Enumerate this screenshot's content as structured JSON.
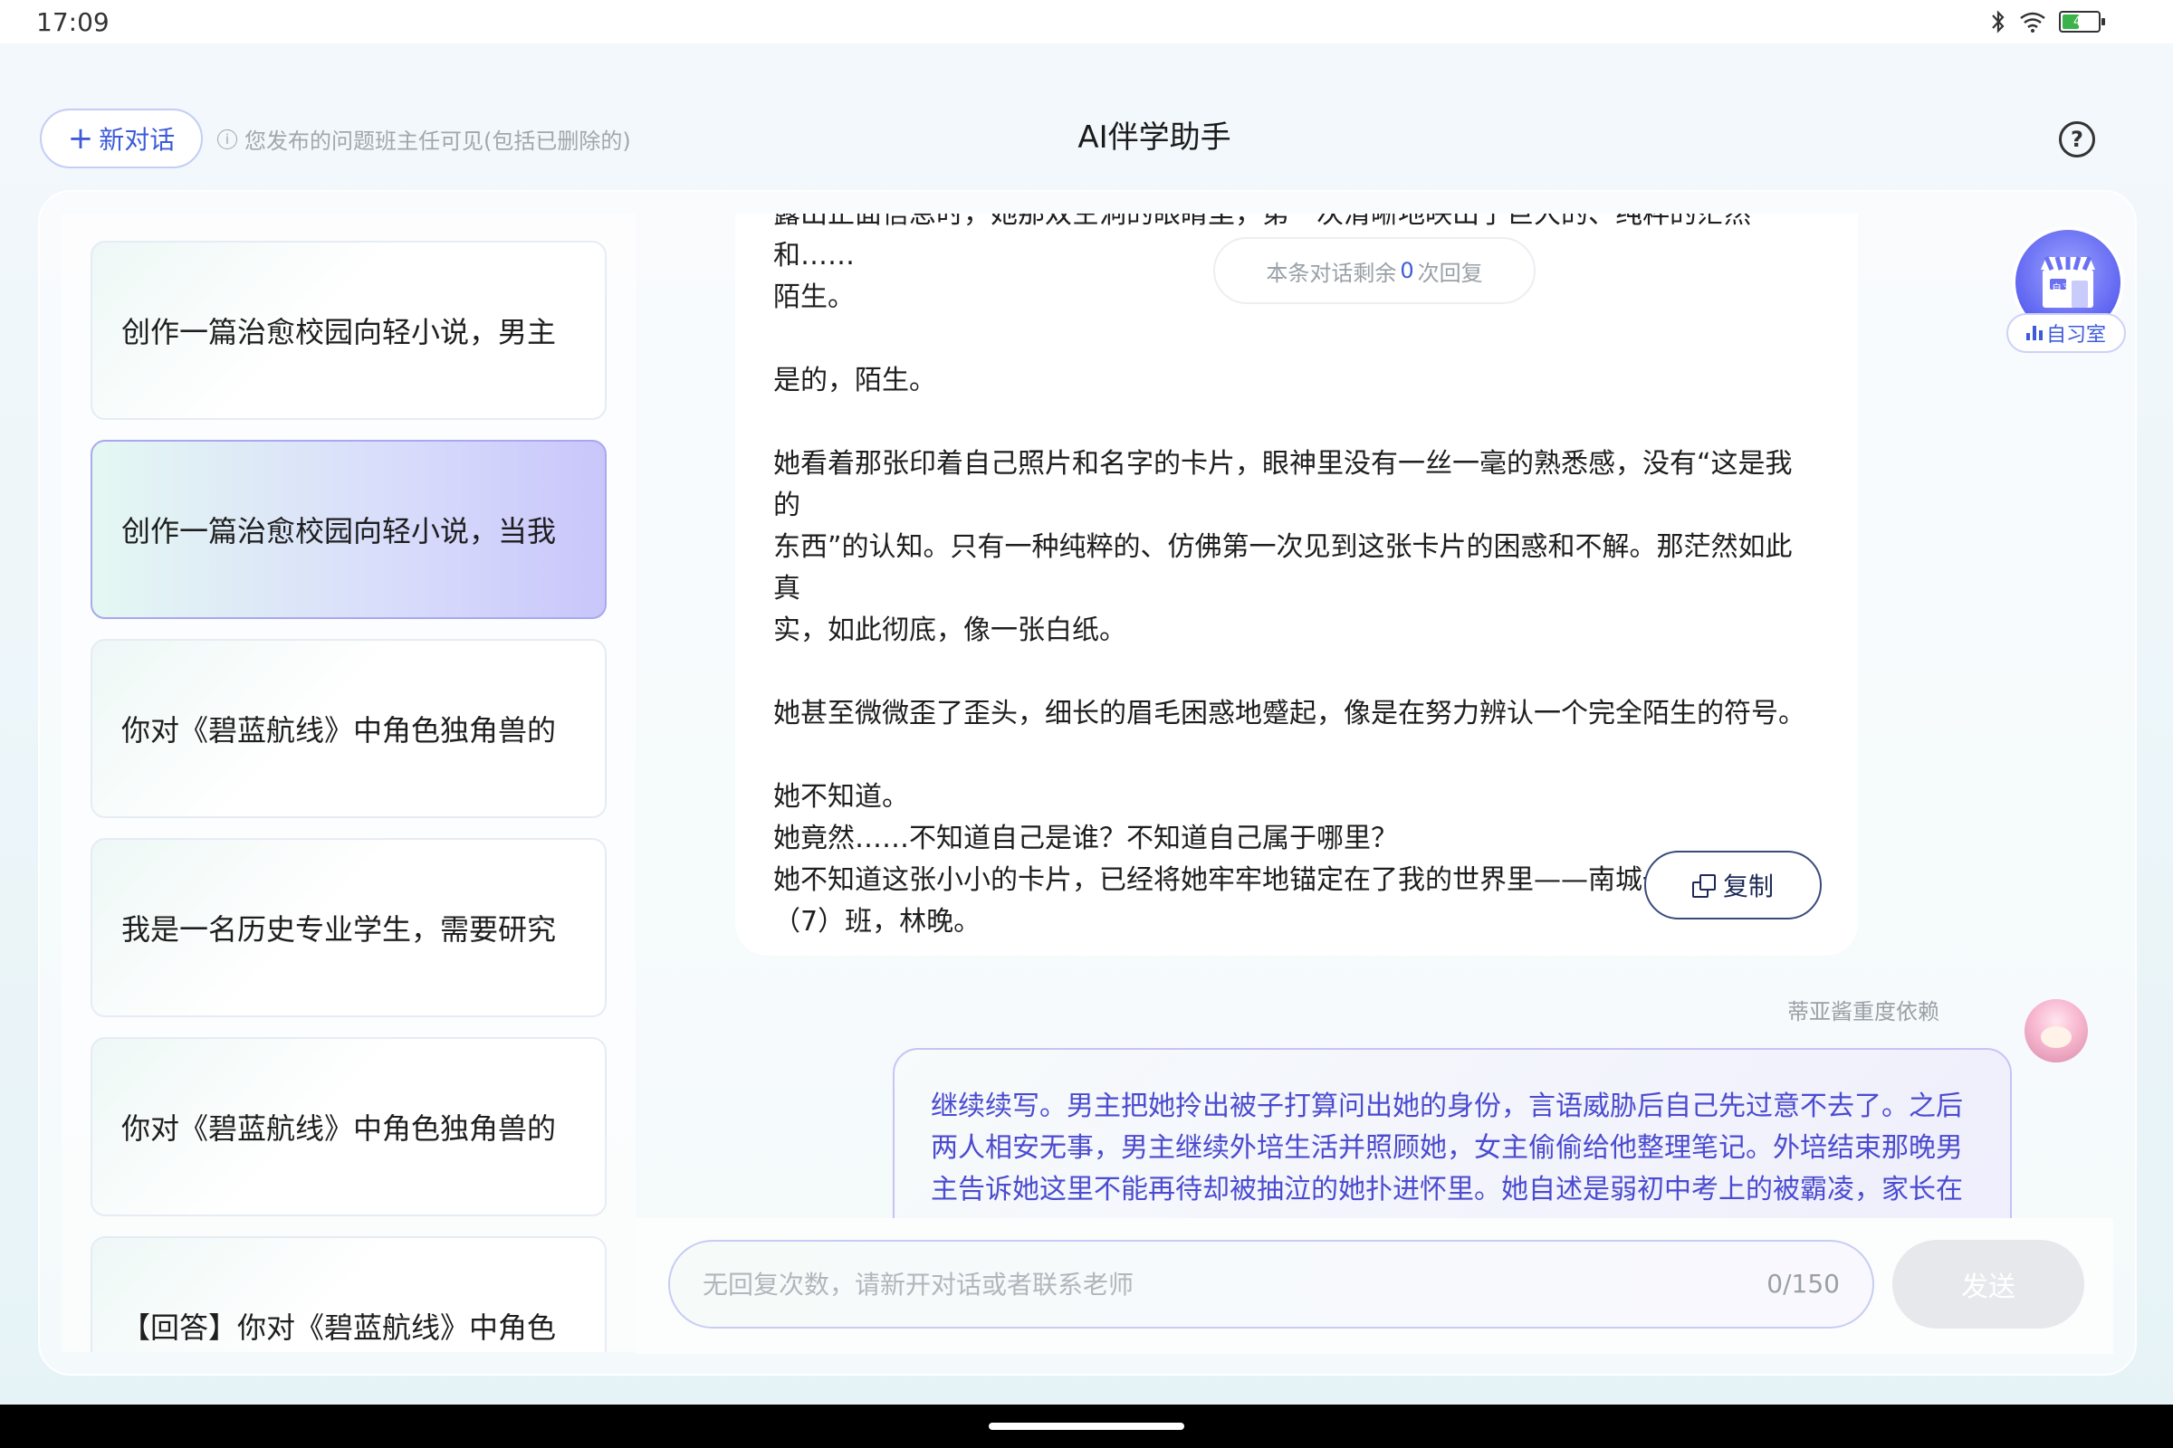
{
  "status_bar": {
    "time": "17:09",
    "battery_level": "44"
  },
  "header": {
    "new_chat_label": "新对话",
    "notice": "您发布的问题班主任可见(包括已删除的)",
    "title": "AI伴学助手"
  },
  "conversations": [
    {
      "title": "创作一篇治愈校园向轻小说，男主",
      "active": false
    },
    {
      "title": "创作一篇治愈校园向轻小说，当我",
      "active": true
    },
    {
      "title": "你对《碧蓝航线》中角色独角兽的",
      "active": false
    },
    {
      "title": "我是一名历史专业学生，需要研究",
      "active": false
    },
    {
      "title": "你对《碧蓝航线》中角色独角兽的",
      "active": false
    },
    {
      "title": "【回答】你对《碧蓝航线》中角色",
      "active": false
    }
  ],
  "ai_message": {
    "lines": [
      "露出正面信息时，她那双空洞的眼睛里，第一次清晰地映出了巨大的、纯粹的茫然和……",
      "陌生。",
      "",
      "是的，陌生。",
      "",
      "她看着那张印着自己照片和名字的卡片，眼神里没有一丝一毫的熟悉感，没有“这是我的",
      "东西”的认知。只有一种纯粹的、仿佛第一次见到这张卡片的困惑和不解。那茫然如此真",
      "实，如此彻底，像一张白纸。",
      "",
      "她甚至微微歪了歪头，细长的眉毛困惑地蹙起，像是在努力辨认一个完全陌生的符号。",
      "",
      "她不知道。",
      "她竟然……不知道自己是谁？不知道自己属于哪里？",
      "她不知道这张小小的卡片，已经将她牢牢地锚定在了我的世界里——南城一中，高一",
      "（7）班，林晚。"
    ],
    "copy_label": "复制"
  },
  "remaining": {
    "prefix": "本条对话剩余",
    "count": "0",
    "suffix": "次回复"
  },
  "user_message": {
    "name": "蒂亚酱重度依赖",
    "text": "继续续写。男主把她拎出被子打算问出她的身份，言语威胁后自己先过意不去了。之后两人相安无事，男主继续外培生活并照顾她，女主偷偷给他整理笔记。外培结束那晚男主告诉她这里不能再待却被抽泣的她扑进怀里。她自述是弱初中考上的被霸凌，家长在"
  },
  "study_room": {
    "label": "自习室",
    "sign": "自习"
  },
  "input": {
    "placeholder": "无回复次数，请新开对话或者联系老师",
    "counter": "0/150",
    "send_label": "发送"
  },
  "colors": {
    "accent": "#3d5bd9",
    "active_item": "#c9c6fb",
    "user_text": "#4b4bd0"
  }
}
